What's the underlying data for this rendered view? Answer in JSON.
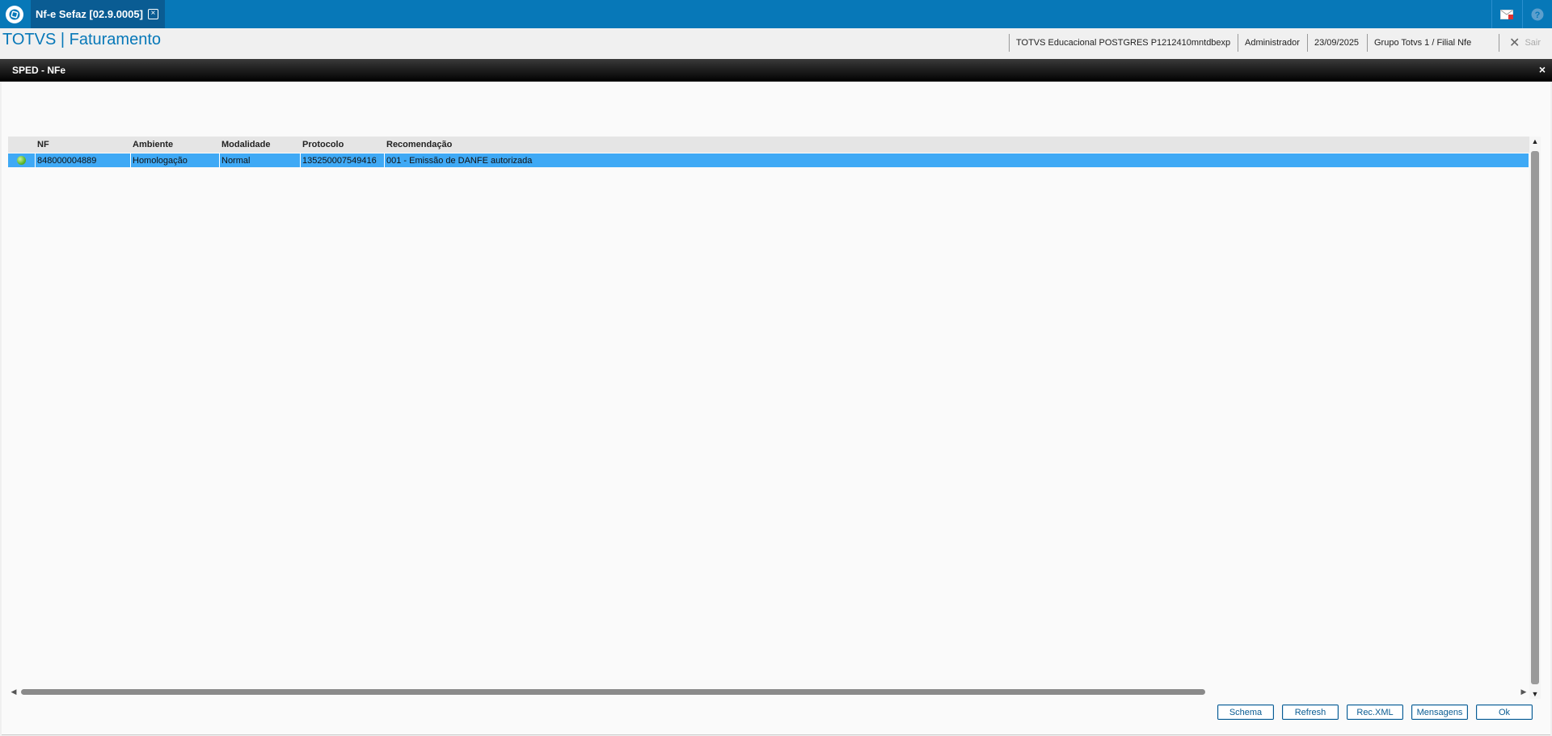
{
  "tab": {
    "label": "Nf-e Sefaz [02.9.0005]"
  },
  "header": {
    "app_title": "TOTVS | Faturamento",
    "environment": "TOTVS Educacional POSTGRES P1212410mntdbexp",
    "user": "Administrador",
    "date": "23/09/2025",
    "branch": "Grupo Totvs 1 / Filial Nfe",
    "exit_label": "Sair"
  },
  "dialog": {
    "title": "SPED - NFe",
    "close": "×"
  },
  "grid": {
    "columns": [
      "",
      "NF",
      "Ambiente",
      "Modalidade",
      "Protocolo",
      "Recomendação"
    ],
    "rows": [
      {
        "status": "green",
        "nf": "848000004889",
        "ambiente": "Homologação",
        "modalidade": "Normal",
        "protocolo": "135250007549416",
        "recomendacao": "001 - Emissão de DANFE autorizada"
      }
    ]
  },
  "buttons": {
    "schema": "Schema",
    "refresh": "Refresh",
    "recxml": "Rec.XML",
    "mensagens": "Mensagens",
    "ok": "Ok"
  },
  "colors": {
    "brand": "#0778b8",
    "selection": "#3fa9f5"
  },
  "icons": {
    "logo": "totvs-logo-icon",
    "mail": "mail-icon",
    "help": "help-icon",
    "status": "status-ok-icon"
  }
}
